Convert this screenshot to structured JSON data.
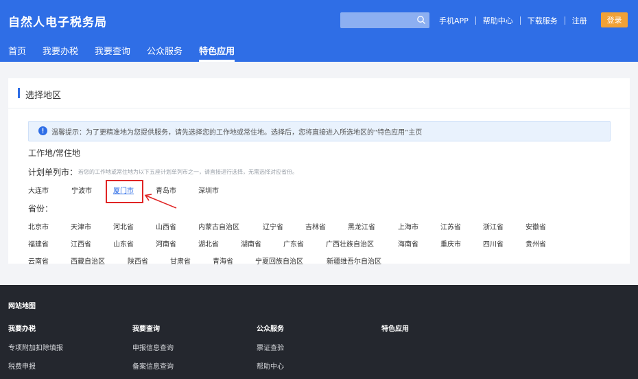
{
  "header": {
    "site_title": "自然人电子税务局",
    "links": [
      "手机APP",
      "帮助中心",
      "下载服务",
      "注册"
    ],
    "login_label": "登录",
    "nav": [
      "首页",
      "我要办税",
      "我要查询",
      "公众服务",
      "特色应用"
    ]
  },
  "card": {
    "title": "选择地区",
    "notice": "温馨提示：为了更精准地为您提供服务，请先选择您的工作地或常住地。选择后，您将直接进入所选地区的“特色应用”主页",
    "section_title": "工作地/常住地",
    "planned_label": "计划单列市：",
    "planned_hint": "若您的工作地或常住地为以下五座计划单列市之一，请直接进行选择，无需选择对应省份。",
    "cities": [
      "大连市",
      "宁波市",
      "厦门市",
      "青岛市",
      "深圳市"
    ],
    "province_label": "省份：",
    "provinces_row1": [
      "北京市",
      "天津市",
      "河北省",
      "山西省",
      "内蒙古自治区",
      "辽宁省",
      "吉林省",
      "黑龙江省",
      "上海市",
      "江苏省",
      "浙江省",
      "安徽省"
    ],
    "provinces_row2": [
      "福建省",
      "江西省",
      "山东省",
      "河南省",
      "湖北省",
      "湖南省",
      "广东省",
      "广西壮族自治区",
      "海南省",
      "重庆市",
      "四川省",
      "贵州省"
    ],
    "provinces_row3": [
      "云南省",
      "西藏自治区",
      "陕西省",
      "甘肃省",
      "青海省",
      "宁夏回族自治区",
      "新疆维吾尔自治区"
    ]
  },
  "footer": {
    "title": "网站地图",
    "columns": [
      {
        "title": "我要办税",
        "links": [
          "专项附加扣除填报",
          "税费申报"
        ]
      },
      {
        "title": "我要查询",
        "links": [
          "申报信息查询",
          "备案信息查询"
        ]
      },
      {
        "title": "公众服务",
        "links": [
          "票证查验",
          "帮助中心"
        ]
      },
      {
        "title": "特色应用",
        "links": []
      }
    ]
  },
  "colors": {
    "primary": "#2f6ee6",
    "login": "#f0a136",
    "highlight_box": "#e02424",
    "footer_bg": "#24272e"
  },
  "icons": [
    "search-icon",
    "info-icon",
    "arrow-annotation-icon"
  ]
}
